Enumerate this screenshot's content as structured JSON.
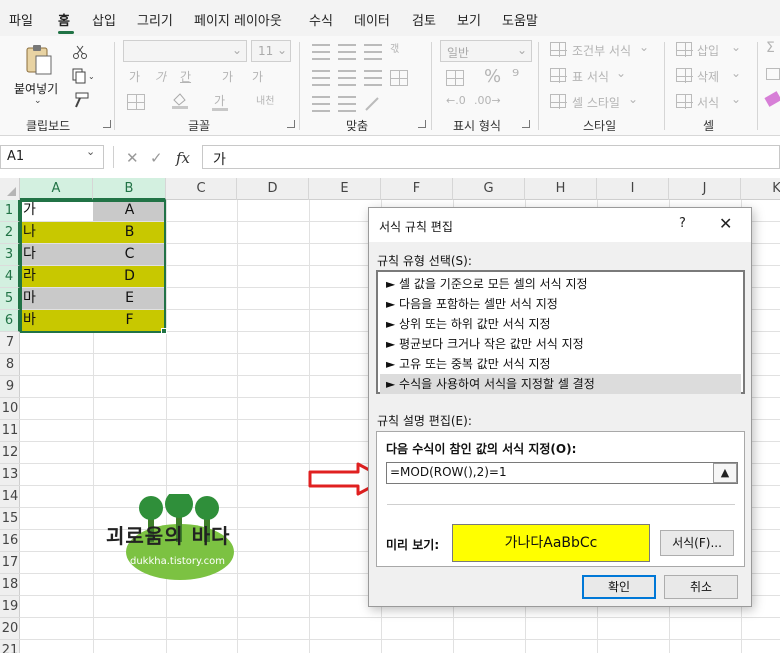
{
  "menu": {
    "items": [
      "파일",
      "홈",
      "삽입",
      "그리기",
      "페이지 레이아웃",
      "수식",
      "데이터",
      "검토",
      "보기",
      "도움말"
    ],
    "active": "홈"
  },
  "ribbon": {
    "clipboard": {
      "paste_label": "붙여넣기",
      "group_label": "클립보드"
    },
    "font": {
      "group_label": "글꼴",
      "size_value": "11",
      "grow_label": "가",
      "shrink_label": "가",
      "bold": "가",
      "italic": "가",
      "underline": "간",
      "char_label": "가",
      "phonetic_label": "내천"
    },
    "alignment": {
      "group_label": "맞춤",
      "wrap_label": "갟"
    },
    "number": {
      "group_label": "표시 형식",
      "format_value": "일반"
    },
    "styles": {
      "group_label": "스타일",
      "conditional": "조건부 서식",
      "table": "표 서식",
      "cell": "셀 스타일"
    },
    "cells": {
      "group_label": "셀",
      "insert": "삽입",
      "delete": "삭제",
      "format": "서식"
    }
  },
  "formula_bar": {
    "name_box": "A1",
    "cancel_symbol": "✕",
    "enter_symbol": "✓",
    "fx_symbol": "fx",
    "value": "가"
  },
  "sheet": {
    "columns": [
      "A",
      "B",
      "C",
      "D",
      "E",
      "F",
      "G",
      "H",
      "I",
      "J",
      "K"
    ],
    "selected_columns": [
      "A",
      "B"
    ],
    "rows": [
      "1",
      "2",
      "3",
      "4",
      "5",
      "6",
      "7",
      "8",
      "9",
      "10",
      "11",
      "12",
      "13",
      "14",
      "15",
      "16",
      "17",
      "18",
      "19",
      "20",
      "21"
    ],
    "selected_rows": [
      "1",
      "2",
      "3",
      "4",
      "5",
      "6"
    ],
    "data": [
      {
        "a": "가",
        "b": "A",
        "fill": "#c9c9c9"
      },
      {
        "a": "나",
        "b": "B",
        "fill": "#c8c800"
      },
      {
        "a": "다",
        "b": "C",
        "fill": "#c9c9c9"
      },
      {
        "a": "라",
        "b": "D",
        "fill": "#c8c800"
      },
      {
        "a": "마",
        "b": "E",
        "fill": "#c9c9c9"
      },
      {
        "a": "바",
        "b": "F",
        "fill": "#c8c800"
      }
    ],
    "a1_fill": "#ffffff"
  },
  "watermark": {
    "title": "괴로움의 바다",
    "url": "dukkha.tistory.com"
  },
  "dialog": {
    "title": "서식 규칙 편집",
    "help": "?",
    "close": "✕",
    "rule_type_label": "규칙 유형 선택(S):",
    "rule_types": [
      "► 셀 값을 기준으로 모든 셀의 서식 지정",
      "► 다음을 포함하는 셀만 서식 지정",
      "► 상위 또는 하위 값만 서식 지정",
      "► 평균보다 크거나 작은 값만 서식 지정",
      "► 고유 또는 중복 값만 서식 지정",
      "► 수식을 사용하여 서식을 지정할 셀 결정"
    ],
    "selected_rule_index": 5,
    "desc_label": "규칙 설명 편집(E):",
    "formula_label": "다음 수식이 참인 값의 서식 지정(O):",
    "formula_value": "=MOD(ROW(),2)=1",
    "preview_label": "미리 보기:",
    "preview_text": "가나다AaBbCc",
    "preview_fill": "#ffff00",
    "format_button": "서식(F)...",
    "ok_button": "확인",
    "cancel_button": "취소"
  }
}
